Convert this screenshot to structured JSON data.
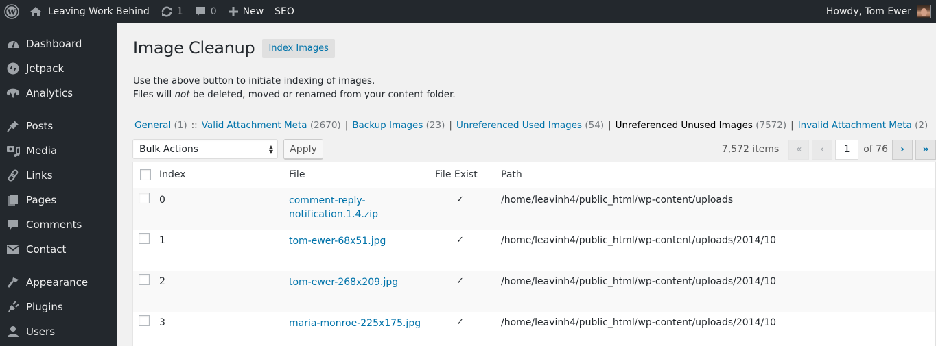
{
  "adminbar": {
    "site_name": "Leaving Work Behind",
    "updates_count": "1",
    "comments_count": "0",
    "new_label": "New",
    "seo_label": "SEO",
    "howdy": "Howdy, Tom Ewer"
  },
  "sidebar": {
    "items": [
      {
        "label": "Dashboard",
        "icon": "dashboard-icon"
      },
      {
        "label": "Jetpack",
        "icon": "jetpack-icon"
      },
      {
        "label": "Analytics",
        "icon": "analytics-icon"
      },
      {
        "label": "Posts",
        "icon": "pin-icon"
      },
      {
        "label": "Media",
        "icon": "media-icon"
      },
      {
        "label": "Links",
        "icon": "link-icon"
      },
      {
        "label": "Pages",
        "icon": "pages-icon"
      },
      {
        "label": "Comments",
        "icon": "comment-icon"
      },
      {
        "label": "Contact",
        "icon": "envelope-icon"
      },
      {
        "label": "Appearance",
        "icon": "paintbrush-icon"
      },
      {
        "label": "Plugins",
        "icon": "plug-icon"
      },
      {
        "label": "Users",
        "icon": "user-icon"
      }
    ]
  },
  "page": {
    "title": "Image Cleanup",
    "index_button": "Index Images",
    "desc_line1": "Use the above button to initiate indexing of images.",
    "desc_line2_pre": "Files will ",
    "desc_line2_em": "not",
    "desc_line2_post": " be deleted, moved or renamed from your content folder."
  },
  "filters": [
    {
      "label": "General",
      "count": "(1)",
      "sep_after": "::",
      "current": false
    },
    {
      "label": "Valid Attachment Meta",
      "count": "(2670)",
      "sep_after": "|",
      "current": false
    },
    {
      "label": "Backup Images",
      "count": "(23)",
      "sep_after": "|",
      "current": false
    },
    {
      "label": "Unreferenced Used Images",
      "count": "(54)",
      "sep_after": "|",
      "current": false
    },
    {
      "label": "Unreferenced Unused Images",
      "count": "(7572)",
      "sep_after": "|",
      "current": true
    },
    {
      "label": "Invalid Attachment Meta",
      "count": "(2)",
      "sep_after": "",
      "current": false
    }
  ],
  "tablenav": {
    "bulk_actions": "Bulk Actions",
    "apply": "Apply",
    "items_count": "7,572 items",
    "first": "«",
    "prev": "‹",
    "current_page": "1",
    "of_pages": "of 76",
    "next": "›",
    "last": "»"
  },
  "table": {
    "headers": {
      "index": "Index",
      "file": "File",
      "exist": "File Exist",
      "path": "Path"
    },
    "rows": [
      {
        "index": "0",
        "file": "comment-reply-notification.1.4.zip",
        "exist": "✓",
        "path": "/home/leavinh4/public_html/wp-content/uploads"
      },
      {
        "index": "1",
        "file": "tom-ewer-68x51.jpg",
        "exist": "✓",
        "path": "/home/leavinh4/public_html/wp-content/uploads/2014/10"
      },
      {
        "index": "2",
        "file": "tom-ewer-268x209.jpg",
        "exist": "✓",
        "path": "/home/leavinh4/public_html/wp-content/uploads/2014/10"
      },
      {
        "index": "3",
        "file": "maria-monroe-225x175.jpg",
        "exist": "✓",
        "path": "/home/leavinh4/public_html/wp-content/uploads/2014/10"
      }
    ]
  }
}
